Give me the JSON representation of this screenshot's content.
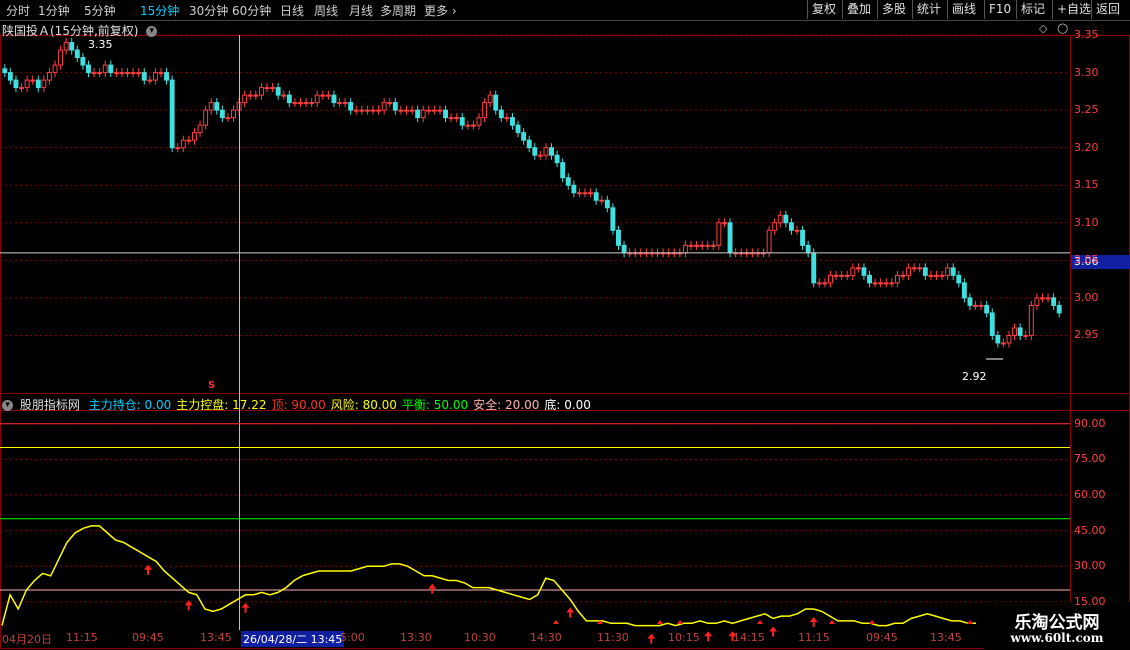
{
  "toolbar": {
    "period_tabs": [
      "分时",
      "1分钟",
      "5分钟",
      "15分钟",
      "30分钟",
      "60分钟",
      "日线",
      "周线",
      "月线",
      "多周期",
      "更多"
    ],
    "active_tab": 3,
    "right_buttons": [
      "复权",
      "叠加",
      "多股",
      "统计",
      "画线",
      "F10",
      "标记",
      "+自选",
      "返回"
    ]
  },
  "price_pane": {
    "title": "陕国投Ａ(15分钟,前复权)",
    "high_label": "3.35",
    "low_label": "2.92",
    "current_price": "3.06",
    "marker_char": "S"
  },
  "indicator_pane": {
    "name": "股朋指标网",
    "items": [
      {
        "label": "主力持仓:",
        "value": "0.00",
        "color": "#00d0ff"
      },
      {
        "label": "主力控盘:",
        "value": "17.22",
        "color": "#ffff00"
      },
      {
        "label": "顶:",
        "value": "90.00",
        "color": "#ff3030"
      },
      {
        "label": "风险:",
        "value": "80.00",
        "color": "#ffff00"
      },
      {
        "label": "平衡:",
        "value": "50.00",
        "color": "#00ff00"
      },
      {
        "label": "安全:",
        "value": "20.00",
        "color": "#ffb0b0"
      },
      {
        "label": "底:",
        "value": "0.00",
        "color": "#ffffff"
      }
    ]
  },
  "x_axis": {
    "labels": [
      "04月20日",
      "11:15",
      "09:45",
      "13:45",
      "26/04/28/二 13:45",
      "5:00",
      "13:30",
      "10:30",
      "14:30",
      "11:30",
      "10:15",
      "14:15",
      "11:15",
      "09:45",
      "13:45"
    ],
    "highlight_index": 4
  },
  "watermark": {
    "cn": "乐淘公式网",
    "url": "www.60lt.com"
  },
  "colors": {
    "up": "#ff4040",
    "down": "#40e0e0",
    "grid": "#8b0000",
    "ma": "#ffff00",
    "crosshair": "#c0c0c0"
  },
  "chart_data": [
    {
      "type": "candlestick",
      "title": "陕国投Ａ(15分钟,前复权)",
      "ylim": [
        2.9,
        3.37
      ],
      "y_ticks": [
        3.35,
        3.3,
        3.25,
        3.2,
        3.15,
        3.1,
        3.05,
        3.0,
        2.95
      ],
      "high": 3.35,
      "low": 2.92,
      "current": 3.06,
      "close_series": [
        3.3,
        3.29,
        3.28,
        3.28,
        3.29,
        3.29,
        3.28,
        3.29,
        3.3,
        3.31,
        3.33,
        3.34,
        3.33,
        3.32,
        3.31,
        3.3,
        3.3,
        3.3,
        3.31,
        3.3,
        3.3,
        3.3,
        3.3,
        3.3,
        3.3,
        3.29,
        3.29,
        3.3,
        3.3,
        3.29,
        3.2,
        3.2,
        3.21,
        3.21,
        3.22,
        3.23,
        3.25,
        3.26,
        3.25,
        3.24,
        3.24,
        3.25,
        3.26,
        3.27,
        3.27,
        3.27,
        3.28,
        3.28,
        3.28,
        3.27,
        3.27,
        3.26,
        3.26,
        3.26,
        3.26,
        3.26,
        3.27,
        3.27,
        3.27,
        3.26,
        3.26,
        3.26,
        3.25,
        3.25,
        3.25,
        3.25,
        3.25,
        3.25,
        3.26,
        3.26,
        3.25,
        3.25,
        3.25,
        3.25,
        3.24,
        3.25,
        3.25,
        3.25,
        3.25,
        3.24,
        3.24,
        3.24,
        3.23,
        3.23,
        3.23,
        3.24,
        3.26,
        3.27,
        3.25,
        3.24,
        3.24,
        3.23,
        3.22,
        3.21,
        3.2,
        3.19,
        3.19,
        3.2,
        3.19,
        3.18,
        3.16,
        3.15,
        3.14,
        3.14,
        3.14,
        3.14,
        3.13,
        3.13,
        3.12,
        3.09,
        3.07,
        3.06,
        3.06,
        3.06,
        3.06,
        3.06,
        3.06,
        3.06,
        3.06,
        3.06,
        3.06,
        3.06,
        3.07,
        3.07,
        3.07,
        3.07,
        3.07,
        3.07,
        3.1,
        3.1,
        3.06,
        3.06,
        3.06,
        3.06,
        3.06,
        3.06,
        3.06,
        3.09,
        3.1,
        3.11,
        3.1,
        3.09,
        3.09,
        3.07,
        3.06,
        3.02,
        3.02,
        3.02,
        3.03,
        3.03,
        3.03,
        3.03,
        3.04,
        3.04,
        3.03,
        3.02,
        3.02,
        3.02,
        3.02,
        3.02,
        3.03,
        3.03,
        3.04,
        3.04,
        3.04,
        3.03,
        3.03,
        3.03,
        3.03,
        3.04,
        3.03,
        3.02,
        3.0,
        2.99,
        2.99,
        2.99,
        2.98,
        2.95,
        2.94,
        2.94,
        2.95,
        2.96,
        2.95,
        2.95,
        2.99,
        3.0,
        3.0,
        3.0,
        2.99,
        2.98
      ]
    },
    {
      "type": "line",
      "title": "股朋指标网",
      "ylim": [
        4,
        100
      ],
      "y_ticks": [
        90,
        75,
        60,
        45,
        30,
        15
      ],
      "reference_lines": [
        {
          "name": "顶",
          "value": 90,
          "color": "#ff3030"
        },
        {
          "name": "风险",
          "value": 80,
          "color": "#ffff00"
        },
        {
          "name": "平衡",
          "value": 50,
          "color": "#00ff00"
        },
        {
          "name": "安全",
          "value": 20,
          "color": "#ffb0b0"
        },
        {
          "name": "底",
          "value": 0,
          "color": "#ffffff"
        }
      ],
      "series": [
        {
          "name": "主力控盘",
          "color": "#ffff00",
          "values": [
            5,
            18,
            12,
            20,
            24,
            27,
            26,
            33,
            40,
            44,
            46,
            47,
            47,
            44,
            41,
            40,
            38,
            36,
            34,
            32,
            28,
            25,
            22,
            19,
            18,
            12,
            11,
            12,
            14,
            16,
            18,
            18,
            19,
            18,
            19,
            21,
            24,
            26,
            27,
            28,
            28,
            28,
            28,
            28,
            29,
            30,
            30,
            30,
            31,
            31,
            30,
            28,
            26,
            26,
            25,
            24,
            24,
            23,
            21,
            21,
            21,
            20,
            19,
            18,
            17,
            16,
            18,
            25,
            24,
            20,
            16,
            11,
            7,
            7,
            7,
            6,
            6,
            6,
            5,
            5,
            5,
            5,
            6,
            5,
            6,
            6,
            7,
            6,
            6,
            7,
            6,
            7,
            8,
            9,
            10,
            8,
            9,
            9,
            10,
            12,
            12,
            11,
            9,
            7,
            7,
            7,
            6,
            6,
            5,
            5,
            6,
            6,
            8,
            9,
            10,
            9,
            8,
            7,
            7,
            6,
            6
          ]
        }
      ],
      "signal_arrows_x_index": [
        18,
        23,
        30,
        53,
        70,
        80,
        87,
        90,
        95,
        100
      ]
    }
  ]
}
